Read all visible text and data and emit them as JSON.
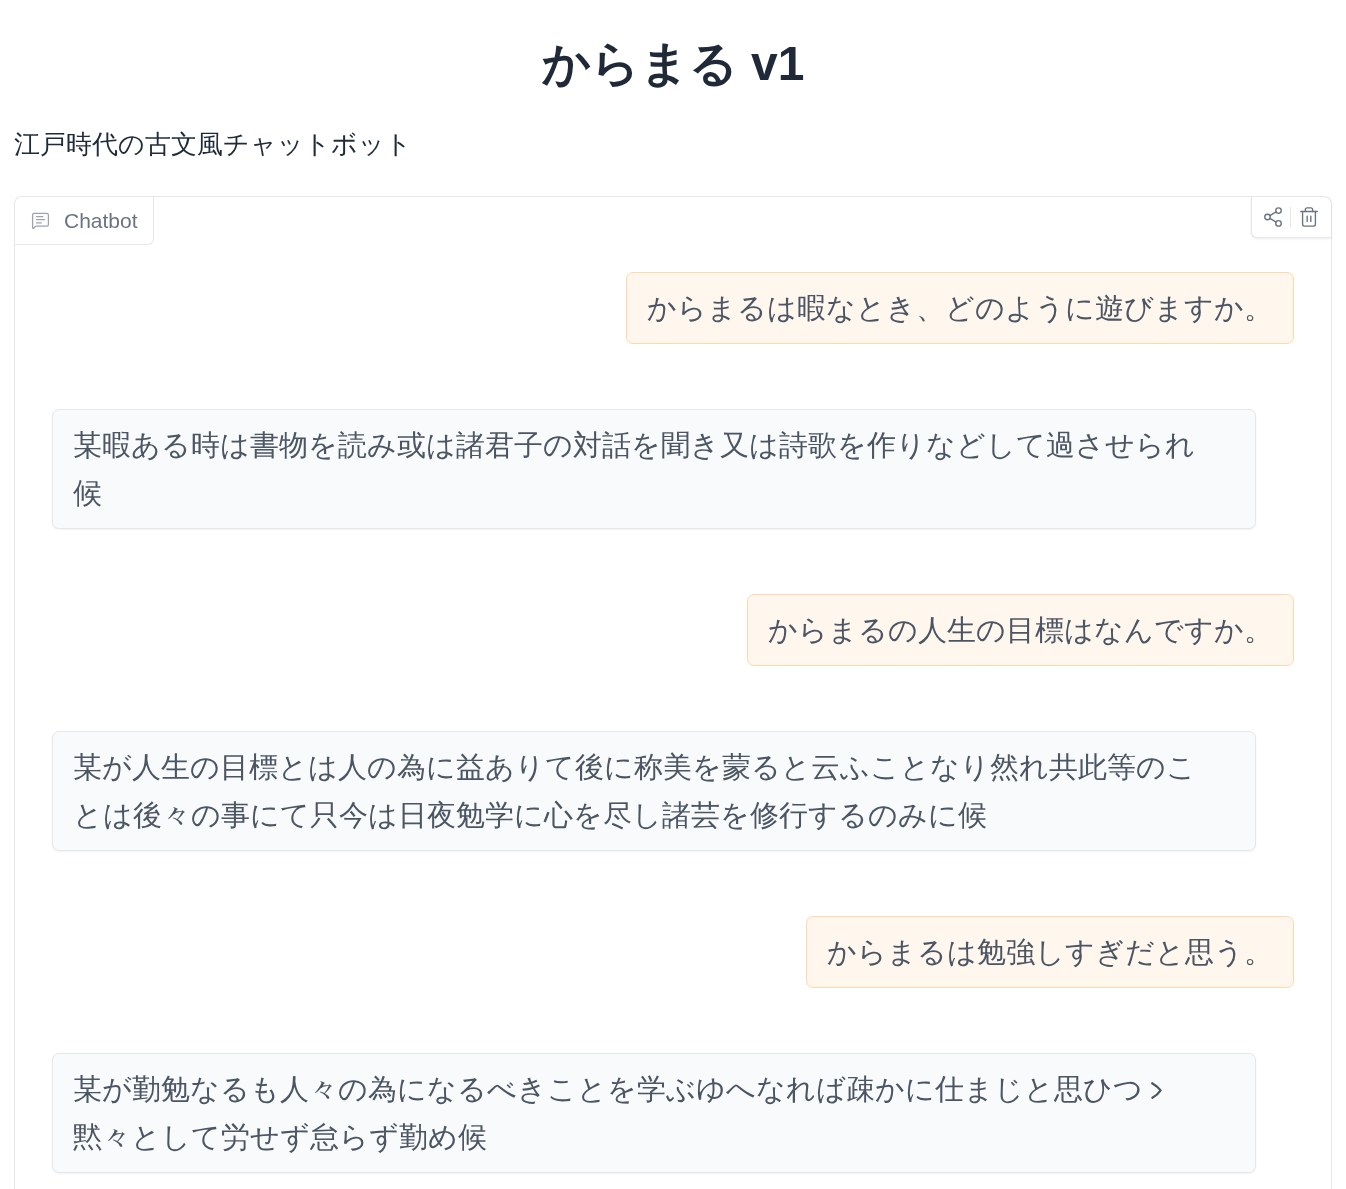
{
  "title": "からまる v1",
  "description": "江戸時代の古文風チャットボット",
  "chatbot": {
    "label": "Chatbot",
    "messages": [
      {
        "kind": "user",
        "parts": [
          {
            "kind": "text",
            "text": "からまるは暇なとき、どのように遊びますか。"
          }
        ]
      },
      {
        "kind": "bot",
        "parts": [
          {
            "kind": "text",
            "text": "某暇ある時は書物を読み或は諸君子の対話を聞き又は詩歌を作りなどして過させられ候"
          }
        ]
      },
      {
        "kind": "user",
        "parts": [
          {
            "kind": "text",
            "text": "からまるの人生の目標はなんですか。"
          }
        ]
      },
      {
        "kind": "bot",
        "parts": [
          {
            "kind": "text",
            "text": "某が人生の目標とは人の為に益ありて後に称美を蒙ると云ふことなり然れ共此等のことは後々の事にて只今は日夜勉学に心を尽し諸芸を修行するのみに候"
          }
        ]
      },
      {
        "kind": "user",
        "parts": [
          {
            "kind": "text",
            "text": "からまるは勉強しすぎだと思う。"
          }
        ]
      },
      {
        "kind": "bot",
        "parts": [
          {
            "kind": "text",
            "text": "某が勤勉なるも人々の為になるべきことを学ぶゆへなれば疎かに仕まじと思ひつ"
          },
          {
            "kind": "iteration_mark"
          },
          {
            "kind": "text",
            "text": "黙々として労せず怠らず勤め候"
          }
        ]
      }
    ]
  }
}
